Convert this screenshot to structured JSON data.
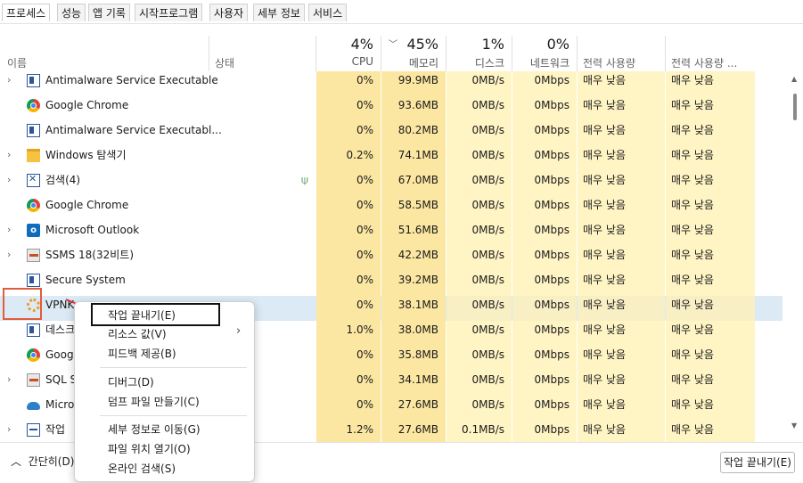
{
  "tabs": [
    "프로세스",
    "성능",
    "앱 기록",
    "시작프로그램",
    "사용자",
    "세부 정보",
    "서비스"
  ],
  "header": {
    "name_label": "이름",
    "status_label": "상태",
    "cpu": {
      "pct": "4%",
      "label": "CPU"
    },
    "memory": {
      "pct": "45%",
      "label": "메모리"
    },
    "disk": {
      "pct": "1%",
      "label": "디스크"
    },
    "network": {
      "pct": "0%",
      "label": "네트워크"
    },
    "power": "전력 사용량",
    "power_trend": "전력 사용량 ..."
  },
  "rows": [
    {
      "expand": "›",
      "icon": "windows-service-icon",
      "name": "Antimalware Service Executable",
      "cpu": "0%",
      "memory": "99.9MB",
      "disk": "0MB/s",
      "network": "0Mbps",
      "power": "매우 낮음",
      "power_trend": "매우 낮음"
    },
    {
      "expand": "",
      "icon": "chrome-icon",
      "name": "Google Chrome",
      "cpu": "0%",
      "memory": "93.6MB",
      "disk": "0MB/s",
      "network": "0Mbps",
      "power": "매우 낮음",
      "power_trend": "매우 낮음"
    },
    {
      "expand": "",
      "icon": "windows-service-icon",
      "name": "Antimalware Service Executabl...",
      "cpu": "0%",
      "memory": "80.2MB",
      "disk": "0MB/s",
      "network": "0Mbps",
      "power": "매우 낮음",
      "power_trend": "매우 낮음"
    },
    {
      "expand": "›",
      "icon": "folder-icon",
      "name": "Windows 탐색기",
      "cpu": "0.2%",
      "memory": "74.1MB",
      "disk": "0MB/s",
      "network": "0Mbps",
      "power": "매우 낮음",
      "power_trend": "매우 낮음"
    },
    {
      "expand": "›",
      "icon": "search-app-icon",
      "name": "검색(4)",
      "cpu": "0%",
      "memory": "67.0MB",
      "disk": "0MB/s",
      "network": "0Mbps",
      "power": "매우 낮음",
      "power_trend": "매우 낮음",
      "suspended": true
    },
    {
      "expand": "",
      "icon": "chrome-icon",
      "name": "Google Chrome",
      "cpu": "0%",
      "memory": "58.5MB",
      "disk": "0MB/s",
      "network": "0Mbps",
      "power": "매우 낮음",
      "power_trend": "매우 낮음"
    },
    {
      "expand": "›",
      "icon": "outlook-icon",
      "name": "Microsoft Outlook",
      "cpu": "0%",
      "memory": "51.6MB",
      "disk": "0MB/s",
      "network": "0Mbps",
      "power": "매우 낮음",
      "power_trend": "매우 낮음"
    },
    {
      "expand": "›",
      "icon": "ssms-icon",
      "name": "SSMS 18(32비트)",
      "cpu": "0%",
      "memory": "42.2MB",
      "disk": "0MB/s",
      "network": "0Mbps",
      "power": "매우 낮음",
      "power_trend": "매우 낮음"
    },
    {
      "expand": "",
      "icon": "windows-service-icon",
      "name": "Secure System",
      "cpu": "0%",
      "memory": "39.2MB",
      "disk": "0MB/s",
      "network": "0Mbps",
      "power": "매우 낮음",
      "power_trend": "매우 낮음"
    },
    {
      "expand": "",
      "icon": "vpn-icon",
      "name": "VPNK",
      "cpu": "0%",
      "memory": "38.1MB",
      "disk": "0MB/s",
      "network": "0Mbps",
      "power": "매우 낮음",
      "power_trend": "매우 낮음",
      "selected": true
    },
    {
      "expand": "",
      "icon": "windows-service-icon",
      "name": "데스크",
      "cpu": "1.0%",
      "memory": "38.0MB",
      "disk": "0MB/s",
      "network": "0Mbps",
      "power": "매우 낮음",
      "power_trend": "매우 낮음"
    },
    {
      "expand": "",
      "icon": "chrome-icon",
      "name": "Googl",
      "cpu": "0%",
      "memory": "35.8MB",
      "disk": "0MB/s",
      "network": "0Mbps",
      "power": "매우 낮음",
      "power_trend": "매우 낮음"
    },
    {
      "expand": "›",
      "icon": "ssms-icon",
      "name": "SQL S",
      "cpu": "0%",
      "memory": "34.1MB",
      "disk": "0MB/s",
      "network": "0Mbps",
      "power": "매우 낮음",
      "power_trend": "매우 낮음"
    },
    {
      "expand": "",
      "icon": "cloud-icon",
      "name": "Micro",
      "cpu": "0%",
      "memory": "27.6MB",
      "disk": "0MB/s",
      "network": "0Mbps",
      "power": "매우 낮음",
      "power_trend": "매우 낮음"
    },
    {
      "expand": "›",
      "icon": "graph-icon",
      "name": "작업",
      "cpu": "1.2%",
      "memory": "27.6MB",
      "disk": "0.1MB/s",
      "network": "0Mbps",
      "power": "매우 낮음",
      "power_trend": "매우 낮음"
    }
  ],
  "context_menu": {
    "items": [
      {
        "label": "작업 끝내기(E)",
        "highlighted": true
      },
      {
        "label": "리소스 값(V)",
        "submenu": true
      },
      {
        "label": "피드백 제공(B)"
      },
      {
        "separator": true
      },
      {
        "label": "디버그(D)"
      },
      {
        "label": "덤프 파일 만들기(C)"
      },
      {
        "separator": true
      },
      {
        "label": "세부 정보로 이동(G)"
      },
      {
        "label": "파일 위치 열기(O)"
      },
      {
        "label": "온라인 검색(S)"
      }
    ]
  },
  "footer": {
    "collapse_label": "간단히(D)",
    "end_task_label": "작업 끝내기(E)"
  },
  "colors": {
    "heat_light": "#fff4c4",
    "heat_medium": "#fce7a2",
    "selected_row": "#dbeaf4",
    "annotation_red": "#e05c3d"
  }
}
